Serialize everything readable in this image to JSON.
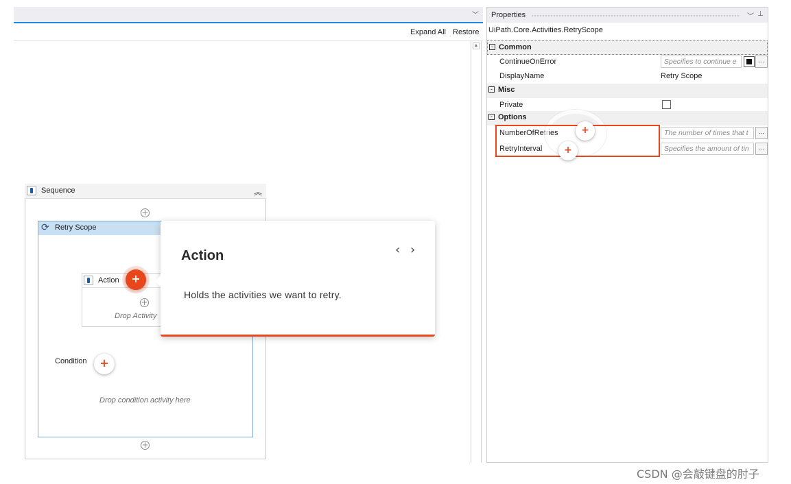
{
  "designer": {
    "toolbar": {
      "expand_all": "Expand All",
      "restore": "Restore"
    },
    "sequence": {
      "title": "Sequence"
    },
    "retry_scope": {
      "title": "Retry Scope",
      "action_label": "Action",
      "drop_activity": "Drop Activity",
      "condition_label": "Condition",
      "drop_condition": "Drop condition activity here"
    }
  },
  "tooltip": {
    "title": "Action",
    "body": "Holds the activities we want to retry.",
    "prev": "‹",
    "next": "›"
  },
  "properties": {
    "title": "Properties",
    "type_name": "UiPath.Core.Activities.RetryScope",
    "categories": {
      "common": "Common",
      "misc": "Misc",
      "options": "Options"
    },
    "rows": {
      "continue_on_error": {
        "name": "ContinueOnError",
        "placeholder": "Specifies to continue e"
      },
      "display_name": {
        "name": "DisplayName",
        "value": "Retry Scope"
      },
      "private": {
        "name": "Private",
        "checked": false
      },
      "number_of_retries": {
        "name": "NumberOfRetries",
        "placeholder": "The number of times that t"
      },
      "retry_interval": {
        "name": "RetryInterval",
        "placeholder": "Specifies the amount of tin"
      }
    }
  },
  "watermark": "CSDN @会敲键盘的肘子",
  "colors": {
    "accent": "#e8471c",
    "selection_blue": "#1e88e5",
    "scope_header": "#c9dff2"
  },
  "icons": {
    "collapse": "double-chevron-up-icon",
    "retry": "refresh-icon",
    "sequence": "sequence-icon",
    "add": "plus-circle-icon"
  }
}
